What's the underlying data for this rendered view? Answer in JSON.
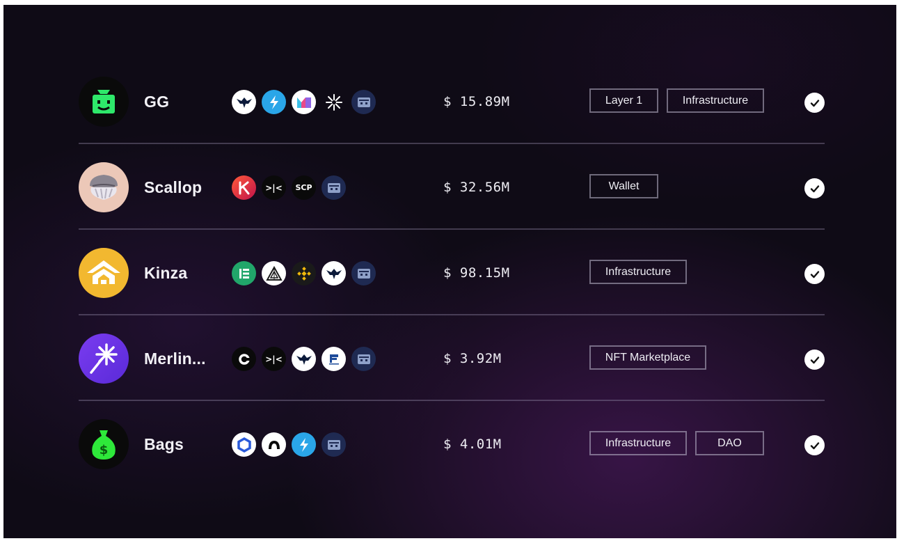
{
  "colors": {
    "background": "#0f0b16",
    "accent_purple": "#3e164e",
    "text": "#f2f1f6",
    "divider": "#5a5468"
  },
  "rows": [
    {
      "name": "GG",
      "logo_icon": "gg-robot-icon",
      "chains": [
        "eagle-chain-icon",
        "lightning-chain-icon",
        "m-chain-icon",
        "star-chain-icon",
        "robot-chain-icon"
      ],
      "tvl": "$ 15.89M",
      "tags": [
        "Layer 1",
        "Infrastructure"
      ],
      "verified": true
    },
    {
      "name": "Scallop",
      "logo_icon": "scallop-shell-icon",
      "chains": [
        "k-chain-icon",
        "arrows-chain-icon",
        "scp-chain-icon",
        "robot-chain-icon"
      ],
      "chain_labels": {
        "arrows": ">|<",
        "scp": "SCP"
      },
      "tvl": "$ 32.56M",
      "tags": [
        "Wallet"
      ],
      "verified": true
    },
    {
      "name": "Kinza",
      "logo_icon": "kinza-house-icon",
      "chains": [
        "ledger-chain-icon",
        "triangle-chain-icon",
        "bnb-chain-icon",
        "eagle-chain-icon",
        "robot-chain-icon"
      ],
      "tvl": "$ 98.15M",
      "tags": [
        "Infrastructure"
      ],
      "verified": true
    },
    {
      "name": "Merlin...",
      "logo_icon": "merlin-star-icon",
      "chains": [
        "c-chain-icon",
        "arrows-chain-icon",
        "eagle-chain-icon",
        "flag-chain-icon",
        "robot-chain-icon"
      ],
      "chain_labels": {
        "arrows": ">|<"
      },
      "tvl": "$ 3.92M",
      "tags": [
        "NFT Marketplace"
      ],
      "verified": true
    },
    {
      "name": "Bags",
      "logo_icon": "money-bag-icon",
      "chains": [
        "hexagon-chain-icon",
        "arch-chain-icon",
        "lightning-chain-icon",
        "robot-chain-icon"
      ],
      "tvl": "$ 4.01M",
      "tags": [
        "Infrastructure",
        "DAO"
      ],
      "verified": true
    }
  ]
}
